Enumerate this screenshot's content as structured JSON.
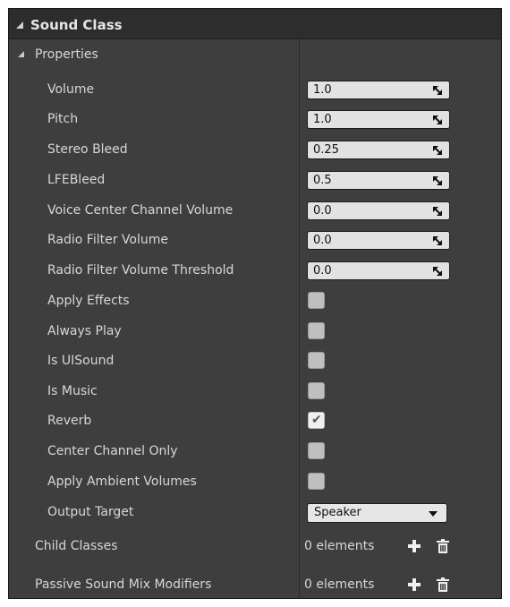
{
  "header": {
    "title": "Sound Class"
  },
  "properties": {
    "label": "Properties",
    "numeric": [
      {
        "label": "Volume",
        "value": "1.0"
      },
      {
        "label": "Pitch",
        "value": "1.0"
      },
      {
        "label": "Stereo Bleed",
        "value": "0.25"
      },
      {
        "label": "LFEBleed",
        "value": "0.5"
      },
      {
        "label": "Voice Center Channel Volume",
        "value": "0.0"
      },
      {
        "label": "Radio Filter Volume",
        "value": "0.0"
      },
      {
        "label": "Radio Filter Volume Threshold",
        "value": "0.0"
      }
    ],
    "checkboxes": [
      {
        "label": "Apply Effects",
        "checked": false
      },
      {
        "label": "Always Play",
        "checked": false
      },
      {
        "label": "Is UISound",
        "checked": false
      },
      {
        "label": "Is Music",
        "checked": false
      },
      {
        "label": "Reverb",
        "checked": true
      },
      {
        "label": "Center Channel Only",
        "checked": false
      },
      {
        "label": "Apply Ambient Volumes",
        "checked": false
      }
    ],
    "output_target": {
      "label": "Output Target",
      "value": "Speaker"
    }
  },
  "child_classes": {
    "label": "Child Classes",
    "count": "0 elements"
  },
  "passive_mix": {
    "label": "Passive Sound Mix Modifiers",
    "count": "0 elements"
  },
  "icons": {
    "collapse": "collapse-triangle-icon",
    "spin": "spin-arrows-icon",
    "add": "plus-icon",
    "delete": "trash-icon",
    "check": "checkmark-icon",
    "dropdown": "chevron-down-icon"
  }
}
